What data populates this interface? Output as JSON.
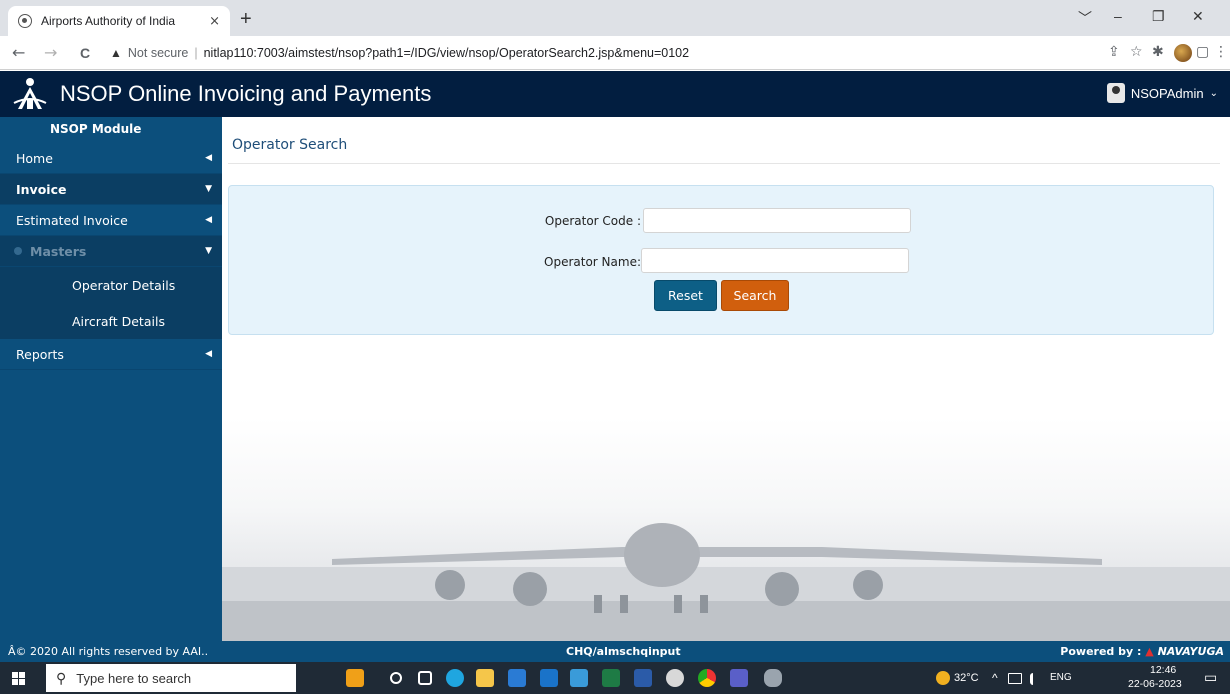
{
  "browser": {
    "tab_title": "Airports Authority of India",
    "tab_close": "×",
    "new_tab": "+",
    "window_controls": [
      "﹀",
      "–",
      "❐",
      "✕"
    ],
    "nav_back": "←",
    "nav_forward": "→",
    "nav_reload": "C",
    "security_icon": "▲",
    "security_text": "Not secure",
    "separator": "|",
    "url": "nitlap110:7003/aimstest/nsop?path1=/IDG/view/nsop/OperatorSearch2.jsp&menu=0102",
    "address_icons": [
      "⇪",
      "☆",
      "✱",
      "▢",
      "⋮"
    ]
  },
  "header": {
    "app_title": "NSOP Online Invoicing and Payments",
    "user_name": "NSOPAdmin",
    "user_caret": "⌄"
  },
  "sidebar": {
    "heading": "NSOP Module",
    "items": [
      {
        "label": "Home",
        "caret": "◀"
      },
      {
        "label": "Invoice",
        "caret": "▼"
      },
      {
        "label": "Estimated Invoice",
        "caret": "◀"
      },
      {
        "label": "Masters",
        "caret": "▼"
      },
      {
        "label": "Operator Details"
      },
      {
        "label": "Aircraft Details"
      },
      {
        "label": "Reports",
        "caret": "◀"
      }
    ]
  },
  "main": {
    "page_title": "Operator Search",
    "form": {
      "operator_code_label": "Operator Code :",
      "operator_code_value": "",
      "operator_name_label": "Operator Name:",
      "operator_name_value": "",
      "reset_label": "Reset",
      "search_label": "Search"
    }
  },
  "footer": {
    "copyright": "Â© 2020 All rights reserved by AAI..",
    "center_text": "CHQ/almschqinput",
    "powered_by": "Powered by :",
    "brand": "NAVAYUGA"
  },
  "taskbar": {
    "search_placeholder": "Type here to search",
    "search_icon": "⚲",
    "temperature": "32°C",
    "tray_arrow": "^",
    "language": "ENG",
    "time": "12:46",
    "date": "22-06-2023",
    "notification_icon": "▭"
  },
  "colors": {
    "header_bg": "#021e40",
    "sidebar_bg": "#0c4f7c",
    "panel_bg": "#e6f3fb",
    "reset_btn": "#0d5f86",
    "search_btn": "#d15f0d",
    "title_color": "#1f4e79"
  }
}
